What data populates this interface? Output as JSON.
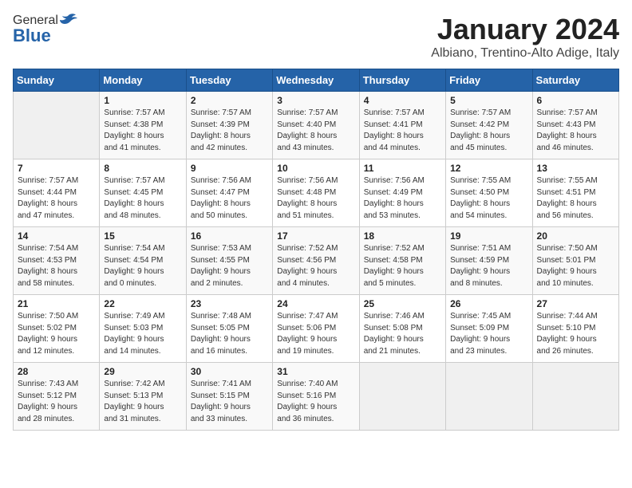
{
  "header": {
    "logo_general": "General",
    "logo_blue": "Blue",
    "month": "January 2024",
    "location": "Albiano, Trentino-Alto Adige, Italy"
  },
  "weekdays": [
    "Sunday",
    "Monday",
    "Tuesday",
    "Wednesday",
    "Thursday",
    "Friday",
    "Saturday"
  ],
  "weeks": [
    [
      {
        "day": "",
        "info": ""
      },
      {
        "day": "1",
        "info": "Sunrise: 7:57 AM\nSunset: 4:38 PM\nDaylight: 8 hours\nand 41 minutes."
      },
      {
        "day": "2",
        "info": "Sunrise: 7:57 AM\nSunset: 4:39 PM\nDaylight: 8 hours\nand 42 minutes."
      },
      {
        "day": "3",
        "info": "Sunrise: 7:57 AM\nSunset: 4:40 PM\nDaylight: 8 hours\nand 43 minutes."
      },
      {
        "day": "4",
        "info": "Sunrise: 7:57 AM\nSunset: 4:41 PM\nDaylight: 8 hours\nand 44 minutes."
      },
      {
        "day": "5",
        "info": "Sunrise: 7:57 AM\nSunset: 4:42 PM\nDaylight: 8 hours\nand 45 minutes."
      },
      {
        "day": "6",
        "info": "Sunrise: 7:57 AM\nSunset: 4:43 PM\nDaylight: 8 hours\nand 46 minutes."
      }
    ],
    [
      {
        "day": "7",
        "info": "Sunrise: 7:57 AM\nSunset: 4:44 PM\nDaylight: 8 hours\nand 47 minutes."
      },
      {
        "day": "8",
        "info": "Sunrise: 7:57 AM\nSunset: 4:45 PM\nDaylight: 8 hours\nand 48 minutes."
      },
      {
        "day": "9",
        "info": "Sunrise: 7:56 AM\nSunset: 4:47 PM\nDaylight: 8 hours\nand 50 minutes."
      },
      {
        "day": "10",
        "info": "Sunrise: 7:56 AM\nSunset: 4:48 PM\nDaylight: 8 hours\nand 51 minutes."
      },
      {
        "day": "11",
        "info": "Sunrise: 7:56 AM\nSunset: 4:49 PM\nDaylight: 8 hours\nand 53 minutes."
      },
      {
        "day": "12",
        "info": "Sunrise: 7:55 AM\nSunset: 4:50 PM\nDaylight: 8 hours\nand 54 minutes."
      },
      {
        "day": "13",
        "info": "Sunrise: 7:55 AM\nSunset: 4:51 PM\nDaylight: 8 hours\nand 56 minutes."
      }
    ],
    [
      {
        "day": "14",
        "info": "Sunrise: 7:54 AM\nSunset: 4:53 PM\nDaylight: 8 hours\nand 58 minutes."
      },
      {
        "day": "15",
        "info": "Sunrise: 7:54 AM\nSunset: 4:54 PM\nDaylight: 9 hours\nand 0 minutes."
      },
      {
        "day": "16",
        "info": "Sunrise: 7:53 AM\nSunset: 4:55 PM\nDaylight: 9 hours\nand 2 minutes."
      },
      {
        "day": "17",
        "info": "Sunrise: 7:52 AM\nSunset: 4:56 PM\nDaylight: 9 hours\nand 4 minutes."
      },
      {
        "day": "18",
        "info": "Sunrise: 7:52 AM\nSunset: 4:58 PM\nDaylight: 9 hours\nand 5 minutes."
      },
      {
        "day": "19",
        "info": "Sunrise: 7:51 AM\nSunset: 4:59 PM\nDaylight: 9 hours\nand 8 minutes."
      },
      {
        "day": "20",
        "info": "Sunrise: 7:50 AM\nSunset: 5:01 PM\nDaylight: 9 hours\nand 10 minutes."
      }
    ],
    [
      {
        "day": "21",
        "info": "Sunrise: 7:50 AM\nSunset: 5:02 PM\nDaylight: 9 hours\nand 12 minutes."
      },
      {
        "day": "22",
        "info": "Sunrise: 7:49 AM\nSunset: 5:03 PM\nDaylight: 9 hours\nand 14 minutes."
      },
      {
        "day": "23",
        "info": "Sunrise: 7:48 AM\nSunset: 5:05 PM\nDaylight: 9 hours\nand 16 minutes."
      },
      {
        "day": "24",
        "info": "Sunrise: 7:47 AM\nSunset: 5:06 PM\nDaylight: 9 hours\nand 19 minutes."
      },
      {
        "day": "25",
        "info": "Sunrise: 7:46 AM\nSunset: 5:08 PM\nDaylight: 9 hours\nand 21 minutes."
      },
      {
        "day": "26",
        "info": "Sunrise: 7:45 AM\nSunset: 5:09 PM\nDaylight: 9 hours\nand 23 minutes."
      },
      {
        "day": "27",
        "info": "Sunrise: 7:44 AM\nSunset: 5:10 PM\nDaylight: 9 hours\nand 26 minutes."
      }
    ],
    [
      {
        "day": "28",
        "info": "Sunrise: 7:43 AM\nSunset: 5:12 PM\nDaylight: 9 hours\nand 28 minutes."
      },
      {
        "day": "29",
        "info": "Sunrise: 7:42 AM\nSunset: 5:13 PM\nDaylight: 9 hours\nand 31 minutes."
      },
      {
        "day": "30",
        "info": "Sunrise: 7:41 AM\nSunset: 5:15 PM\nDaylight: 9 hours\nand 33 minutes."
      },
      {
        "day": "31",
        "info": "Sunrise: 7:40 AM\nSunset: 5:16 PM\nDaylight: 9 hours\nand 36 minutes."
      },
      {
        "day": "",
        "info": ""
      },
      {
        "day": "",
        "info": ""
      },
      {
        "day": "",
        "info": ""
      }
    ]
  ]
}
